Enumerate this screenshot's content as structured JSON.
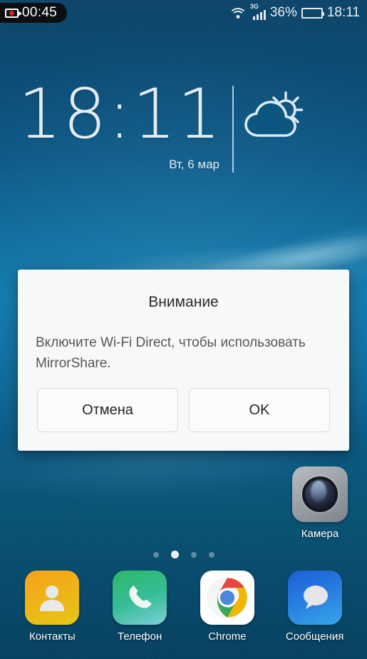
{
  "statusbar": {
    "recording": {
      "icon": "video-camera-icon",
      "time": "00:45"
    },
    "wifi_icon": "wifi-icon",
    "network_type": "3G",
    "signal_icon": "signal-bars-icon",
    "battery_percent": "36%",
    "battery_icon": "battery-icon",
    "battery_level": 36,
    "clock": "18:11"
  },
  "clock_widget": {
    "time": "18:11",
    "date": "Вт, 6 мар",
    "weather_icon": "partly-cloudy-icon"
  },
  "dialog": {
    "title": "Внимание",
    "message": "Включите Wi-Fi Direct, чтобы использовать MirrorShare.",
    "cancel_label": "Отмена",
    "ok_label": "OK"
  },
  "desktop": {
    "camera": {
      "label": "Камера",
      "icon": "camera-icon"
    },
    "page_dots": {
      "count": 4,
      "active_index": 1
    }
  },
  "dock": {
    "apps": [
      {
        "label": "Контакты",
        "icon": "contacts-icon"
      },
      {
        "label": "Телефон",
        "icon": "phone-icon"
      },
      {
        "label": "Chrome",
        "icon": "chrome-icon"
      },
      {
        "label": "Сообщения",
        "icon": "messages-icon"
      }
    ]
  },
  "colors": {
    "wallpaper_top": "#0d4468",
    "wallpaper_mid": "#0f78ad",
    "wallpaper_bottom": "#06415f",
    "dialog_bg": "#f7f8f9",
    "record_dot": "#e02222",
    "contacts": "#f0b018",
    "phone": "#35bd95",
    "messages": "#2a7ee0"
  }
}
